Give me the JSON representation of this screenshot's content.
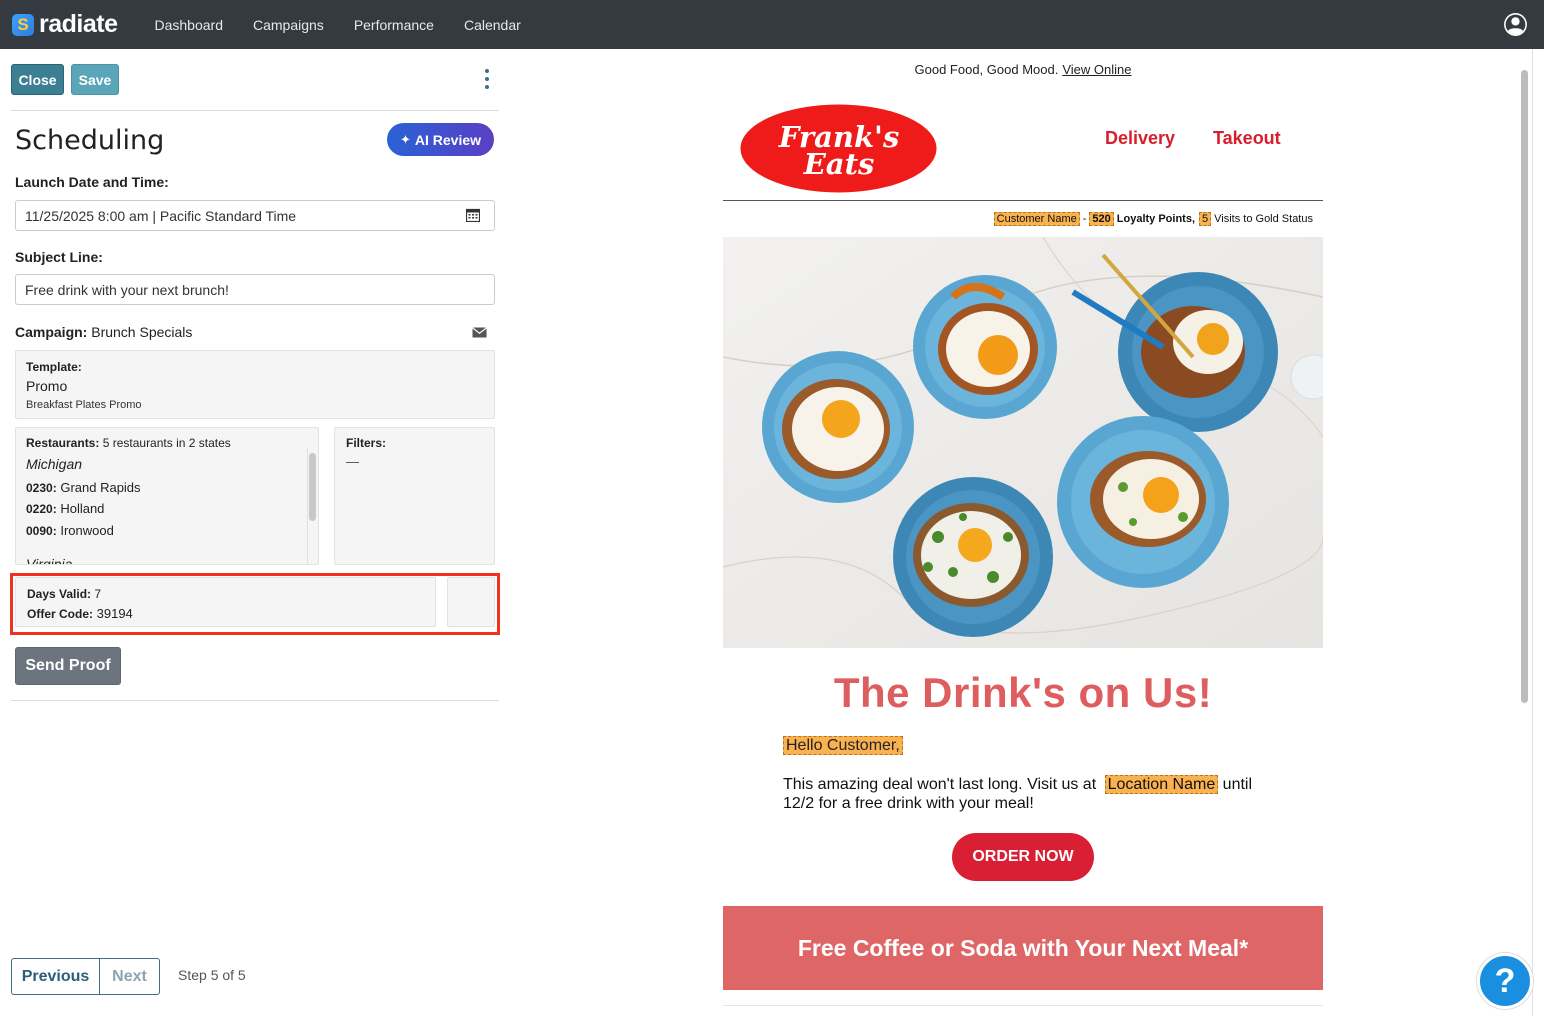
{
  "app": {
    "brand": "radiate",
    "brand_mark": "S"
  },
  "nav": {
    "items": [
      "Dashboard",
      "Campaigns",
      "Performance",
      "Calendar"
    ]
  },
  "toolbar": {
    "close_label": "Close",
    "save_label": "Save"
  },
  "page": {
    "title": "Scheduling",
    "ai_review_label": "AI Review"
  },
  "form": {
    "launch_label": "Launch Date and Time:",
    "launch_value": "11/25/2025 8:00 am | Pacific Standard Time",
    "subject_label": "Subject Line:",
    "subject_value": "Free drink with your next brunch!",
    "campaign_label": "Campaign:",
    "campaign_value": "Brunch Specials"
  },
  "template": {
    "label": "Template:",
    "name": "Promo",
    "sub": "Breakfast Plates Promo"
  },
  "restaurants": {
    "label": "Restaurants:",
    "summary": "5 restaurants in 2 states",
    "state1": "Michigan",
    "rows": [
      {
        "code": "0230:",
        "name": "Grand Rapids"
      },
      {
        "code": "0220:",
        "name": "Holland"
      },
      {
        "code": "0090:",
        "name": "Ironwood"
      }
    ],
    "state2": "Virginia"
  },
  "filters": {
    "label": "Filters:",
    "value": "—"
  },
  "offer": {
    "days_label": "Days Valid:",
    "days_value": "7",
    "code_label": "Offer Code:",
    "code_value": "39194"
  },
  "send_proof_label": "Send Proof",
  "pager": {
    "previous": "Previous",
    "next": "Next",
    "step": "Step 5 of 5"
  },
  "email": {
    "preheader": "Good Food, Good Mood.",
    "view_online": "View Online",
    "logo_line1": "Frank's",
    "logo_line2": "Eats",
    "nav_delivery": "Delivery",
    "nav_takeout": "Takeout",
    "tag_customer": "Customer Name",
    "dash": "-",
    "tag_points": "520",
    "loyalty_points": "Loyalty Points,",
    "tag_visits": "5",
    "visits_text": "Visits to Gold Status",
    "headline": "The Drink's on Us!",
    "hello": "Hello Customer,",
    "body_pre": "This amazing deal won't last long. Visit us at",
    "tag_location": "Location Name",
    "body_post": "until 12/2 for a free drink with your meal!",
    "order_button": "ORDER NOW",
    "banner": "Free Coffee or Soda with Your Next Meal*"
  },
  "help_label": "?",
  "colors": {
    "nav_bg": "#343a40",
    "accent_red": "#d71f2c",
    "headline": "#de5d5e",
    "banner": "#de6666",
    "tag": "#f9b24f",
    "highlight": "#f0321e"
  }
}
